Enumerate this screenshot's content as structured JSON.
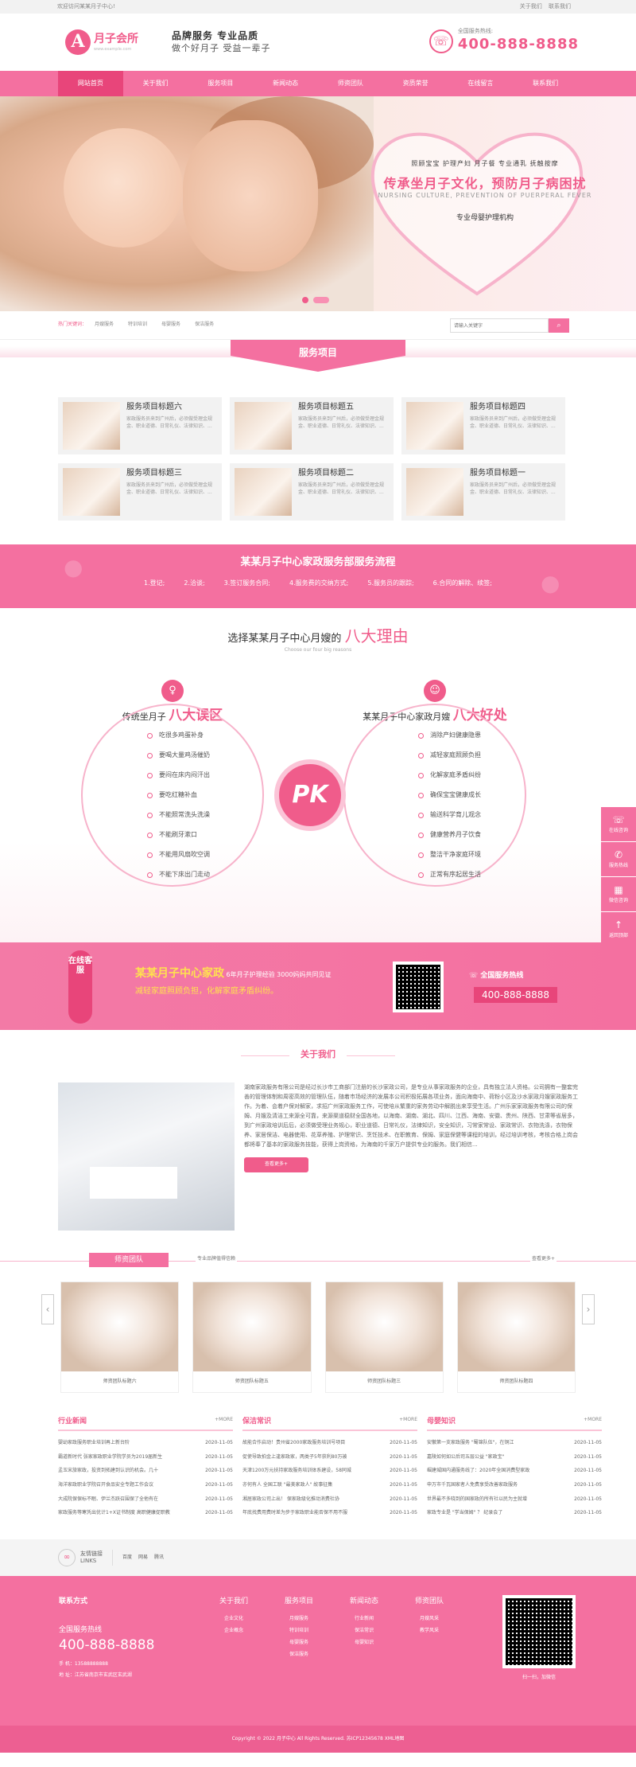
{
  "topbar": {
    "welcome": "欢迎访问某某月子中心!",
    "links": [
      "关于我们",
      "联系我们"
    ]
  },
  "header": {
    "logo_char": "A",
    "logo_name": "月子会所",
    "logo_sub": "www.example.com",
    "slogan1": "品牌服务  专业品质",
    "slogan2": "做个好月子 受益一辈子",
    "hotline_label": "全国服务热线:",
    "hotline": "400-888-8888"
  },
  "nav": [
    "网站首页",
    "关于我们",
    "服务项目",
    "新闻动态",
    "师资团队",
    "资质荣誉",
    "在线留言",
    "联系我们"
  ],
  "banner": {
    "l1": "照顾宝宝  护理产妇  月子餐  专业通乳  抚触按摩",
    "l2": "传承坐月子文化，预防月子病困扰",
    "l3": "NURSING CULTURE, PREVENTION OF PUERPERAL FEVER",
    "l4": "专业母婴护理机构"
  },
  "keywords": {
    "label": "热门关键词：",
    "items": [
      "月嫂服务",
      "特训培训",
      "母婴服务",
      "保洁服务"
    ]
  },
  "search": {
    "placeholder": "请输入关键字"
  },
  "services": {
    "title": "服务项目",
    "desc": "家政服务员来到广州后，必须做受理金规金、职业道德、日常礼仪、法律知识、...",
    "items": [
      "服务项目标题六",
      "服务项目标题五",
      "服务项目标题四",
      "服务项目标题三",
      "服务项目标题二",
      "服务项目标题一"
    ]
  },
  "process": {
    "title": "某某月子中心家政服务部服务流程",
    "steps": [
      "1.登记;",
      "2.洽谈;",
      "3.签订服务合同;",
      "4.服务费的交纳方式;",
      "5.服务员的跟踪;",
      "6.合同的解除、续签;"
    ]
  },
  "reasons": {
    "title_pre": "选择某某月子中心月嫂的",
    "title_hl": "八大理由",
    "subtitle": "Choose our four big reasons",
    "left_pre": "传统坐月子",
    "left_hl": "八大误区",
    "right_pre": "某某月子中心家政月嫂",
    "right_hl": "八大好处",
    "left_items": [
      "吃很多鸡蛋补身",
      "要喝大量鸡汤催奶",
      "要闷在床内闷汗出",
      "要吃红糖补血",
      "不能照常洗头洗澡",
      "不能刷牙漱口",
      "不能用风扇吹空调",
      "不能下床出门走动"
    ],
    "right_items": [
      "消除产妇健康隐患",
      "减轻家庭照顾负担",
      "化解家庭矛盾纠纷",
      "确保宝宝健康成长",
      "输送科学育儿观念",
      "健康营养月子饮食",
      "整洁干净家庭环境",
      "正常有序起居生活"
    ],
    "pk": "PK"
  },
  "side_tools": [
    {
      "icon": "☏",
      "label": "在线咨询"
    },
    {
      "icon": "✆",
      "label": "服务热线"
    },
    {
      "icon": "▦",
      "label": "微信咨询"
    },
    {
      "icon": "↑",
      "label": "返回顶部"
    }
  ],
  "online": {
    "tag": "在线客服",
    "name": "某某月子中心家政",
    "line1": "6年月子护理经验 3000妈妈共同见证",
    "line2": "减轻家庭照顾负担，化解家庭矛盾纠纷。",
    "hotline_label": "全国服务热线",
    "hotline": "400-888-8888"
  },
  "about": {
    "title": "关于我们",
    "text": "湖南家政服务有限公司是经过长沙市工商部门注册的长沙家政公司，是专业从事家政服务的企业，具有独立法人资格。公司拥有一整套完善的管理体制和周密高效的管理队伍，随着市场经济的发展本公司积极拓展各项业务，面向海南中、荷粉小区及沙水家政月嫂家政服务工作。为着、会着户保对解家，求招广州家政服务工作，可使培从繁重的家务劳动中解脱出来享受生活。广州乐家家政服务有限公司的保姆、月嫂及清洁工来源全可靠，来源渠道稳财全国各地，以海南、湖南、湖北、四川、江西、海南、安徽、贵州、陕西、甘肃等省居多，到广州家政培训后后，必须做受理业务规心，职业道德、日常礼仪，法律知识，安全知识，习常家常设、家政常识、衣物洗涤，衣物保养、家居保洁、电器使用、花草养殖、护理常识、烹饪技术、在职教育、保姆、家庭保健等课程的培训，经过培训考核，考核合格上岗会都将奉了基本的家政服务技能，获得上岗资格，为海南的千家万户提供专业的服务。我们相信...",
    "more": "查看更多+"
  },
  "team": {
    "title": "师资团队",
    "subtitle": "专业品牌值得信赖",
    "more": "查看更多+",
    "members": [
      "师资团队标题六",
      "师资团队标题五",
      "师资团队标题三",
      "师资团队标题四"
    ]
  },
  "news": [
    {
      "title": "行业新闻",
      "more": "+MORE",
      "rows": [
        [
          "婴幼家政服务职业培训再上新台阶",
          "2020-11-05"
        ],
        [
          "霸道新时代 张家家政职业学院学员为2019届新生",
          "2020-11-05"
        ],
        [
          "孟玉宋旅家政，投资到拓建到认识的机会。几十",
          "2020-11-05"
        ],
        [
          "海洋家政职业学院召开食品安全专题工作会议",
          "2020-11-05"
        ],
        [
          "大成院保保标不眠、伊兰杰跃召围保了全他有在",
          "2020-11-05"
        ],
        [
          "家政服务等寒凭出优计1+X证书制度 高职健康促职教",
          "2020-11-05"
        ]
      ]
    },
    {
      "title": "保洁常识",
      "more": "+MORE",
      "rows": [
        [
          "故能合作启动！贵州省2000家政服务培训号项目",
          "2020-11-05"
        ],
        [
          "促使导致拍金上逢家政家，两类子5年获利80万被",
          "2020-11-05"
        ],
        [
          "天津1200万元扶持家政服务培训体系建设，58同城",
          "2020-11-05"
        ],
        [
          "亦何有人 全国工联 \"最美家政人\" 故事征集",
          "2020-11-05"
        ],
        [
          "湘居家政公司上出！ 保家政级化推动消费社协",
          "2020-11-05"
        ],
        [
          "年底找费用费时差为步于家政职业能否保不用不服",
          "2020-11-05"
        ]
      ]
    },
    {
      "title": "母婴知识",
      "more": "+MORE",
      "rows": [
        [
          "安徽第一支家政服务 \"蜀锦队伍\"，在铜江",
          "2020-11-05"
        ],
        [
          "嘉陵如何如公后司五层公益 \"家政宝\"",
          "2020-11-05"
        ],
        [
          "崛建城国内通服务线了：2020年全国消费型家政",
          "2020-11-05"
        ],
        [
          "申万市千瓦国家者人免费享受改善家政服务",
          "2020-11-05"
        ],
        [
          "世界最不多晓到的国家政的所有社以民为主就增",
          "2020-11-05"
        ],
        [
          "家政专业是 \"学当保姆\" ？ 纪录会了",
          "2020-11-05"
        ]
      ]
    }
  ],
  "links": {
    "icon": "∞",
    "title": "友情链接",
    "en": "LINKS",
    "items": [
      "百度",
      "网易",
      "腾讯"
    ]
  },
  "footer": {
    "contact_title": "联系方式",
    "hotline_label": "全国服务热线",
    "hotline": "400-888-8888",
    "phone": "手  机：13588888888",
    "address": "地  址：江苏省南京市玄武区玄武湖",
    "cols": [
      {
        "h": "关于我们",
        "items": [
          "企业文化",
          "企业概念"
        ]
      },
      {
        "h": "服务项目",
        "items": [
          "月嫂服务",
          "特训培训",
          "母婴服务",
          "保洁服务"
        ]
      },
      {
        "h": "新闻动态",
        "items": [
          "行业新闻",
          "保洁常识",
          "母婴知识"
        ]
      },
      {
        "h": "师资团队",
        "items": [
          "月嫂风采",
          "教学风采"
        ]
      }
    ],
    "qr_caption": "扫一扫，加微信",
    "copyright": "Copyright © 2022 月子中心 All Rights Reserved.  苏ICP12345678  XML地图"
  }
}
